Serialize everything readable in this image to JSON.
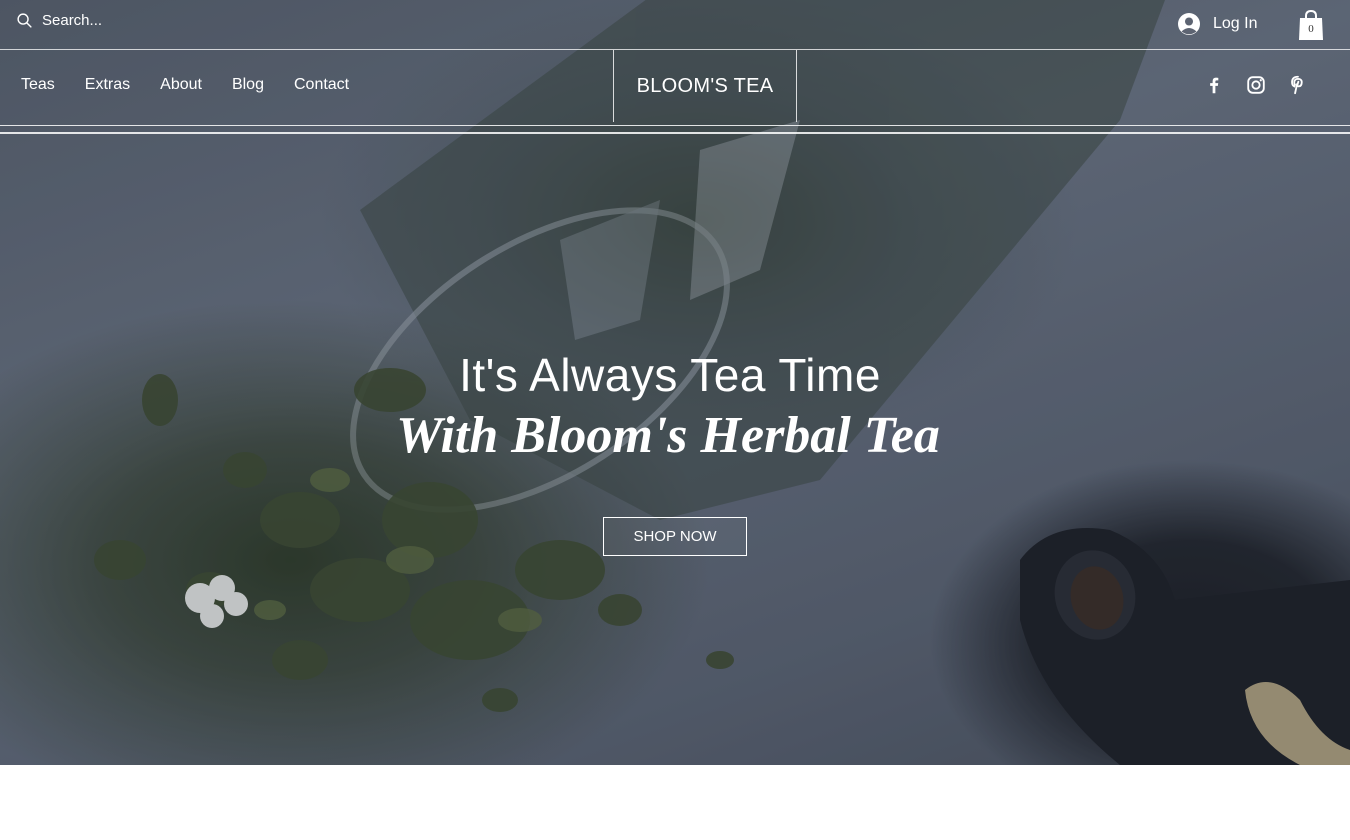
{
  "search": {
    "placeholder": "Search..."
  },
  "account": {
    "login_label": "Log In"
  },
  "cart": {
    "count": "0"
  },
  "nav": {
    "items": [
      {
        "label": "Teas"
      },
      {
        "label": "Extras"
      },
      {
        "label": "About"
      },
      {
        "label": "Blog"
      },
      {
        "label": "Contact"
      }
    ]
  },
  "brand": {
    "name": "BLOOM'S TEA"
  },
  "social": {
    "icons": [
      "facebook-icon",
      "instagram-icon",
      "pinterest-icon"
    ]
  },
  "hero": {
    "headline": "It's Always Tea Time",
    "subheadline": "With Bloom's Herbal Tea",
    "cta_label": "SHOP NOW",
    "image_subject": "loose leaf tea spilling from glass jar with teapot"
  },
  "colors": {
    "text": "#ffffff",
    "page_background": "#ffffff"
  }
}
